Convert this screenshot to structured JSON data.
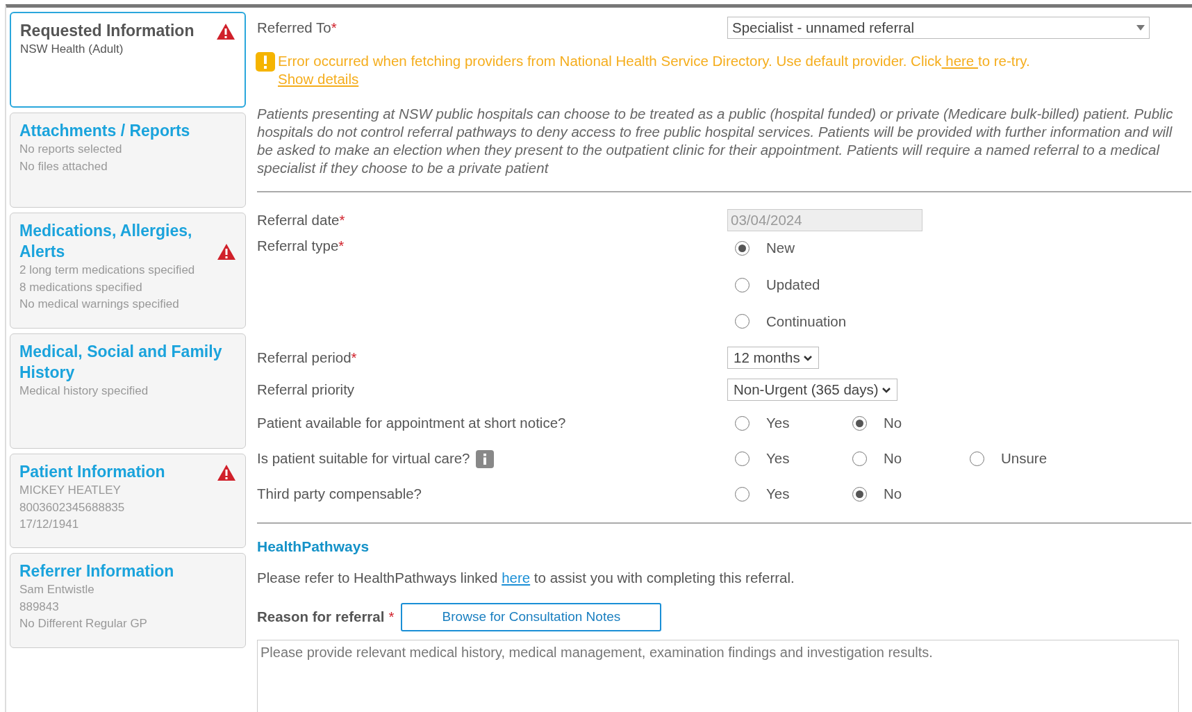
{
  "sidebar": {
    "items": [
      {
        "title": "Requested Information",
        "selected": true,
        "warning": true,
        "lines": [
          "NSW Health (Adult)"
        ]
      },
      {
        "title": "Attachments / Reports",
        "selected": false,
        "warning": false,
        "lines": [
          "No reports selected",
          "No files attached"
        ]
      },
      {
        "title": "Medications, Allergies, Alerts",
        "selected": false,
        "warning": true,
        "lines": [
          "2 long term medications specified",
          "8 medications specified",
          "No medical warnings specified"
        ]
      },
      {
        "title": "Medical, Social and Family History",
        "selected": false,
        "warning": false,
        "lines": [
          "Medical history specified"
        ]
      },
      {
        "title": "Patient Information",
        "selected": false,
        "warning": true,
        "lines": [
          "MICKEY HEATLEY",
          "8003602345688835",
          "17/12/1941"
        ]
      },
      {
        "title": "Referrer Information",
        "selected": false,
        "warning": false,
        "lines": [
          "Sam Entwistle",
          "889843",
          "No Different Regular GP"
        ]
      }
    ]
  },
  "referred_to": {
    "label": "Referred To",
    "required_mark": "*",
    "value": "Specialist - unnamed referral"
  },
  "error": {
    "text_before": "Error occurred when fetching providers from National Health Service Directory. Use default provider. Click",
    "link": " here ",
    "text_after": "to re-try.",
    "details_link": "Show details"
  },
  "notice": "Patients presenting at NSW public hospitals can choose to be treated as a public (hospital funded) or private (Medicare bulk-billed) patient. Public hospitals do not control referral pathways to deny access to free public hospital services. Patients will be provided with further information and will be asked to make an election when they present to the outpatient clinic for their appointment. Patients will require a named referral to a medical specialist if they choose to be a private patient",
  "fields": [
    {
      "kind": "date",
      "label": "Referral date",
      "required_mark": "*",
      "info": false,
      "value": "03/04/2024"
    },
    {
      "kind": "radio-stack",
      "label": "Referral type",
      "required_mark": "*",
      "info": false,
      "options": [
        {
          "label": "New",
          "selected": true
        },
        {
          "label": "Updated",
          "selected": false
        },
        {
          "label": "Continuation",
          "selected": false
        }
      ]
    },
    {
      "kind": "select",
      "label": "Referral period",
      "required_mark": "*",
      "info": false,
      "value": "12 months"
    },
    {
      "kind": "select",
      "label": "Referral priority",
      "info": false,
      "value": "Non-Urgent (365 days)"
    },
    {
      "kind": "radio-row",
      "label": "Patient available for appointment at short notice?",
      "info": false,
      "options": [
        {
          "label": "Yes",
          "selected": false
        },
        {
          "label": "No",
          "selected": true
        }
      ]
    },
    {
      "kind": "radio-row",
      "label": "Is patient suitable for virtual care?",
      "info": true,
      "options": [
        {
          "label": "Yes",
          "selected": false
        },
        {
          "label": "No",
          "selected": false
        },
        {
          "label": "Unsure",
          "selected": false
        }
      ]
    },
    {
      "kind": "radio-row",
      "label": "Third party compensable?",
      "info": false,
      "options": [
        {
          "label": "Yes",
          "selected": false
        },
        {
          "label": "No",
          "selected": true
        }
      ]
    }
  ],
  "healthpathways": {
    "heading": "HealthPathways",
    "text_before": "Please refer to HealthPathways linked",
    "link": "here",
    "text_after": "to assist you with completing this referral."
  },
  "reason": {
    "label": "Reason for referral",
    "required_mark": "*",
    "button": "Browse for Consultation Notes",
    "placeholder": "Please provide relevant medical history, medical management, examination findings and investigation results."
  }
}
